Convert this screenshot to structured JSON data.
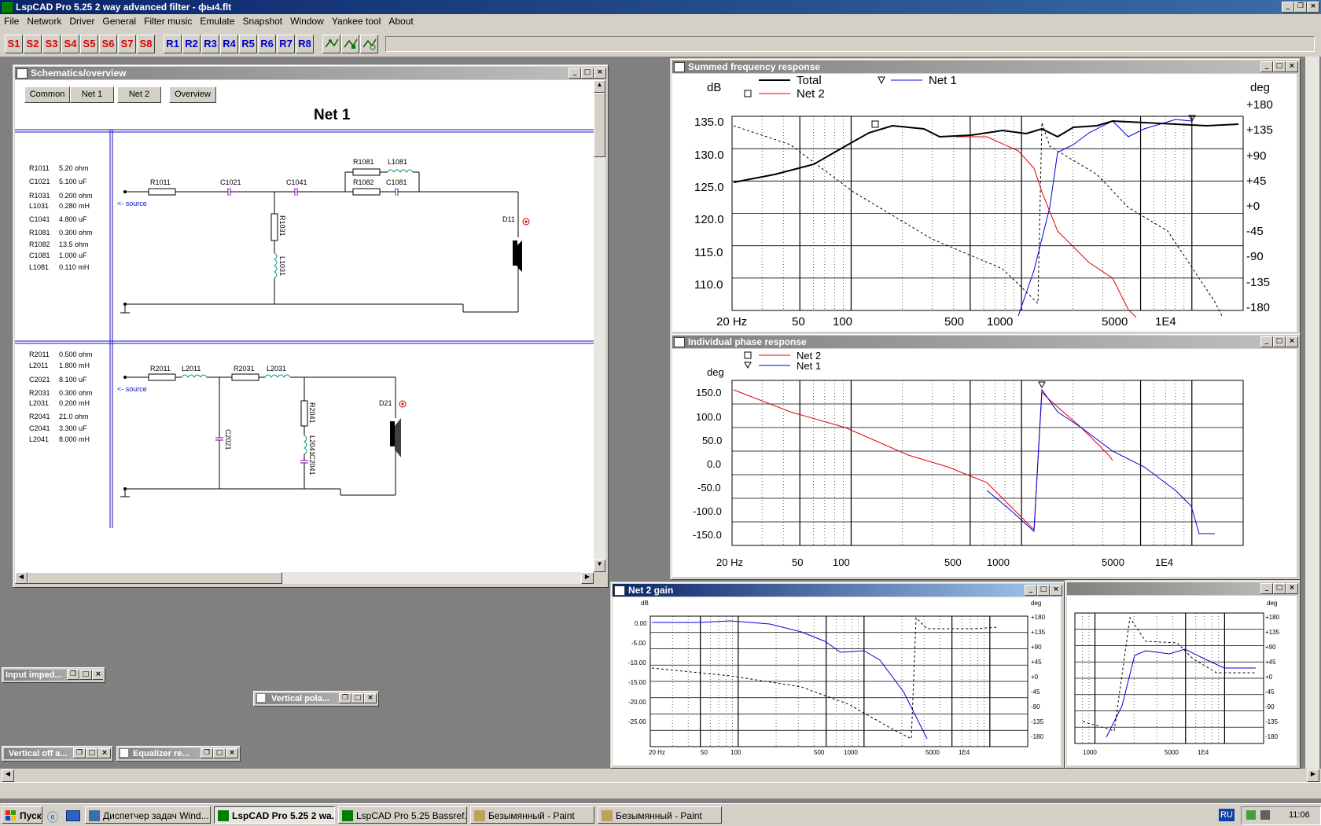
{
  "app": {
    "title": "LspCAD Pro 5.25 2 way advanced filter - фы4.flt"
  },
  "menu": [
    "File",
    "Network",
    "Driver",
    "General",
    "Filter music",
    "Emulate",
    "Snapshot",
    "Window",
    "Yankee tool",
    "About"
  ],
  "toolbar": {
    "s_buttons": [
      "S1",
      "S2",
      "S3",
      "S4",
      "S5",
      "S6",
      "S7",
      "S8"
    ],
    "r_buttons": [
      "R1",
      "R2",
      "R3",
      "R4",
      "R5",
      "R6",
      "R7",
      "R8"
    ]
  },
  "schematics": {
    "title": "Schematics/overview",
    "tabs": [
      "Common",
      "Net 1",
      "Net 2",
      "Overview"
    ],
    "heading": "Net 1",
    "net1_values": [
      {
        "name": "R1011",
        "value": "5.20 ohm"
      },
      {
        "name": "C1021",
        "value": "5.100 uF"
      },
      {
        "name": "R1031",
        "value": "0.200 ohm"
      },
      {
        "name": "L1031",
        "value": "0.280 mH"
      },
      {
        "name": "C1041",
        "value": "4.800 uF"
      },
      {
        "name": "R1081",
        "value": "0.300 ohm"
      },
      {
        "name": "R1082",
        "value": "13.5 ohm"
      },
      {
        "name": "C1081",
        "value": "1.000 uF"
      },
      {
        "name": "L1081",
        "value": "0.110 mH"
      }
    ],
    "net2_values": [
      {
        "name": "R2011",
        "value": "0.500 ohm"
      },
      {
        "name": "L2011",
        "value": "1.800 mH"
      },
      {
        "name": "C2021",
        "value": "8.100 uF"
      },
      {
        "name": "R2031",
        "value": "0.300 ohm"
      },
      {
        "name": "L2031",
        "value": "0.200 mH"
      },
      {
        "name": "R2041",
        "value": "21.0 ohm"
      },
      {
        "name": "C2041",
        "value": "3.300 uF"
      },
      {
        "name": "L2041",
        "value": "8.000 mH"
      }
    ],
    "net1_labels": {
      "R1011": "R1011",
      "C1021": "C1021",
      "C1041": "C1041",
      "R1081": "R1081",
      "L1081": "L1081",
      "R1082": "R1082",
      "C1081": "C1081",
      "R1031": "R1031",
      "L1031": "L1031",
      "D11": "D11",
      "source": "<- source"
    },
    "net2_labels": {
      "R2011": "R2011",
      "L2011": "L2011",
      "R2031": "R2031",
      "L2031": "L2031",
      "C2021": "C2021",
      "R2041": "R2041",
      "L2041": "L2041",
      "C2041": "C2041",
      "D21": "D21",
      "source": "<- source"
    }
  },
  "summed": {
    "title": "Summed frequency response",
    "ylabel": "dB",
    "y2label": "deg",
    "legend": [
      "Total",
      "Net 2",
      "Net 1"
    ],
    "yticks": [
      "135.0",
      "130.0",
      "125.0",
      "120.0",
      "115.0",
      "110.0"
    ],
    "y2ticks": [
      "+180",
      "+135",
      "+90",
      "+45",
      "+0",
      "-45",
      "-90",
      "-135",
      "-180"
    ],
    "xticks": [
      "20 Hz",
      "50",
      "100",
      "500",
      "1000",
      "5000",
      "1E4"
    ]
  },
  "phase": {
    "title": "Individual phase response",
    "ylabel": "deg",
    "legend": [
      "Net 2",
      "Net 1"
    ],
    "yticks": [
      "150.0",
      "100.0",
      "50.0",
      "0.0",
      "-50.0",
      "-100.0",
      "-150.0"
    ],
    "xticks": [
      "20 Hz",
      "50",
      "100",
      "500",
      "1000",
      "5000",
      "1E4"
    ]
  },
  "net2gain": {
    "title": "Net 2 gain",
    "ylabel": "dB",
    "y2label": "deg",
    "yticks": [
      "0.00",
      "-5.00",
      "-10.00",
      "-15.00",
      "-20.00",
      "-25.00"
    ],
    "y2ticks": [
      "+180",
      "+135",
      "+90",
      "+45",
      "+0",
      "-45",
      "-90",
      "-135",
      "-180"
    ],
    "xticks": [
      "20 Hz",
      "50",
      "100",
      "500",
      "1000",
      "5000",
      "1E4"
    ]
  },
  "net1gain": {
    "y2label": "deg",
    "y2ticks": [
      "+180",
      "+135",
      "+90",
      "+45",
      "+0",
      "-45",
      "-90",
      "-135",
      "-180"
    ],
    "xticks": [
      "1000",
      "5000",
      "1E4"
    ]
  },
  "minimized": [
    {
      "title": "Input imped..."
    },
    {
      "title": "Vertical pola..."
    },
    {
      "title": "Vertical off a..."
    },
    {
      "title": "Equalizer re..."
    }
  ],
  "taskbar": {
    "start": "Пуск",
    "tasks": [
      "Диспетчер задач Wind...",
      "LspCAD Pro 5.25 2 wa...",
      "LspCAD Pro 5.25 Bassref...",
      "Безымянный - Paint",
      "Безымянный - Paint"
    ],
    "lang": "RU",
    "clock": "11:06"
  }
}
